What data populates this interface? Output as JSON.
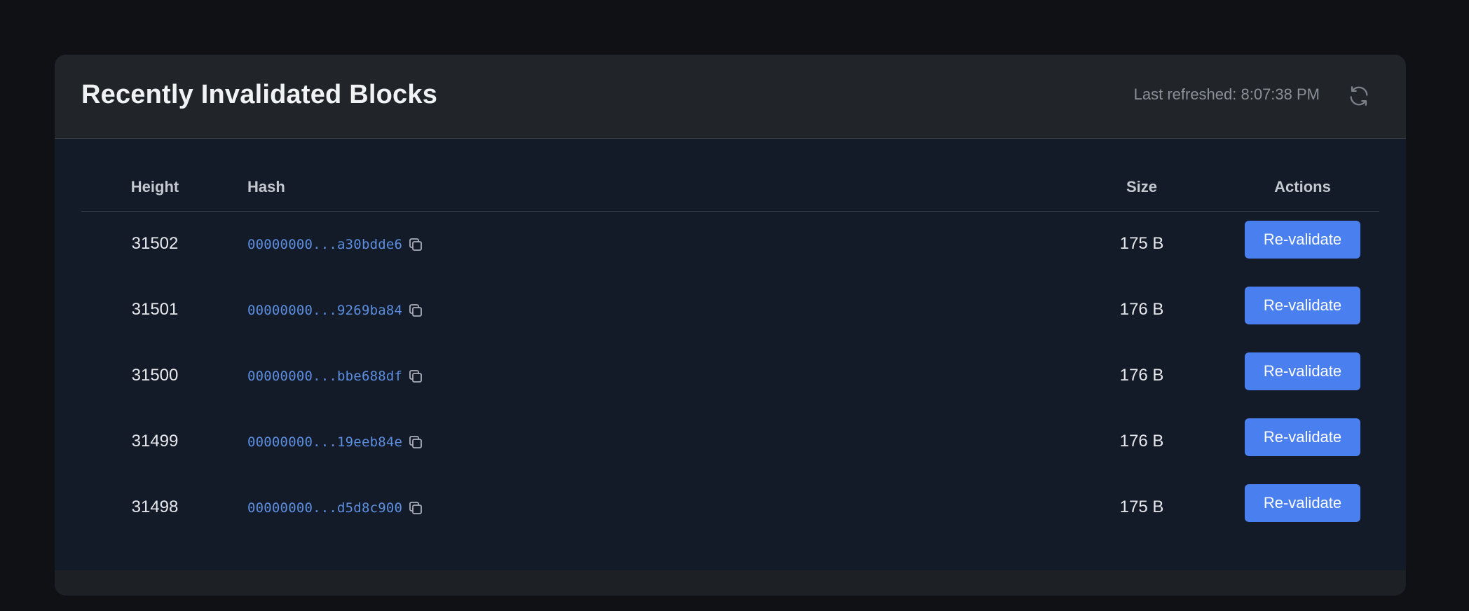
{
  "card": {
    "title": "Recently Invalidated Blocks",
    "last_refreshed": "Last refreshed: 8:07:38 PM",
    "refresh_icon": "refresh-icon"
  },
  "table": {
    "columns": {
      "height": "Height",
      "hash": "Hash",
      "size": "Size",
      "actions": "Actions"
    },
    "rows": [
      {
        "height": "31502",
        "hash": "00000000...a30bdde6",
        "size": "175 B",
        "action": "Re-validate"
      },
      {
        "height": "31501",
        "hash": "00000000...9269ba84",
        "size": "176 B",
        "action": "Re-validate"
      },
      {
        "height": "31500",
        "hash": "00000000...bbe688df",
        "size": "176 B",
        "action": "Re-validate"
      },
      {
        "height": "31499",
        "hash": "00000000...19eeb84e",
        "size": "176 B",
        "action": "Re-validate"
      },
      {
        "height": "31498",
        "hash": "00000000...d5d8c900",
        "size": "175 B",
        "action": "Re-validate"
      }
    ]
  },
  "colors": {
    "page_bg": "#0f1115",
    "card_header_bg": "#212428",
    "table_bg": "#131a28",
    "accent": "#4a7ff0",
    "hash_link": "#5d8fe0"
  }
}
